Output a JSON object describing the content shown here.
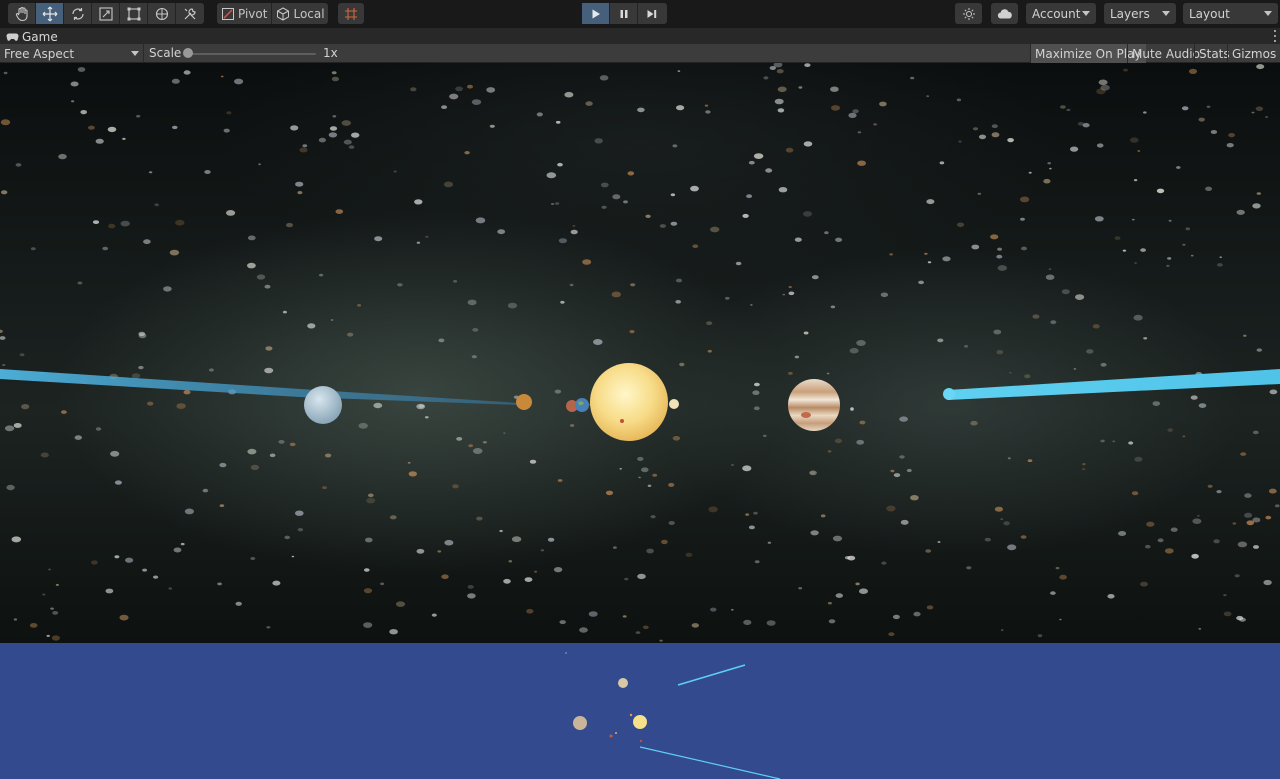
{
  "toolbar": {
    "tools": [
      {
        "name": "hand-tool",
        "icon": "hand-icon",
        "active": false
      },
      {
        "name": "move-tool",
        "icon": "move-arrows-icon",
        "active": true
      },
      {
        "name": "rotate-tool",
        "icon": "rotate-icon",
        "active": false
      },
      {
        "name": "scale-tool",
        "icon": "scale-icon",
        "active": false
      },
      {
        "name": "rect-tool",
        "icon": "rect-transform-icon",
        "active": false
      },
      {
        "name": "transform-tool",
        "icon": "transform-icon",
        "active": false
      },
      {
        "name": "custom-tool",
        "icon": "tools-icon",
        "active": false
      }
    ],
    "pivot_label": "Pivot",
    "local_label": "Local",
    "play_state": "playing",
    "account_label": "Account",
    "layers_label": "Layers",
    "layout_label": "Layout"
  },
  "tab": {
    "game_label": "Game"
  },
  "game_controls": {
    "aspect_label": "Free Aspect",
    "scale_label": "Scale",
    "scale_value": "1x",
    "maximize_label": "Maximize On Play",
    "mute_label": "Mute Audio",
    "stats_label": "Stats",
    "gizmos_label": "Gizmos"
  },
  "colors": {
    "accent_active": "#46607c",
    "minimap_background": "#334a8e",
    "orbit_trail": "#4fc3e8"
  }
}
